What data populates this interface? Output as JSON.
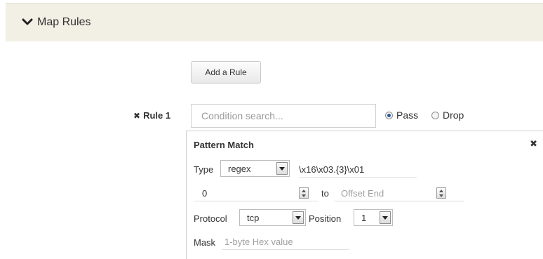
{
  "section": {
    "title": "Map Rules"
  },
  "actions": {
    "add_rule_label": "Add a Rule"
  },
  "rule": {
    "label": "Rule 1",
    "condition_placeholder": "Condition search...",
    "pass_label": "Pass",
    "drop_label": "Drop",
    "selected": "Pass"
  },
  "pattern_match": {
    "title": "Pattern Match",
    "type_label": "Type",
    "type_value": "regex",
    "pattern_value": "\\x16\\x03.{3}\\x01",
    "offset_start": "0",
    "to_label": "to",
    "offset_end_placeholder": "Offset End",
    "protocol_label": "Protocol",
    "protocol_value": "tcp",
    "position_label": "Position",
    "position_value": "1",
    "mask_label": "Mask",
    "mask_placeholder": "1-byte Hex value"
  },
  "icons": {
    "collapse": "chevron-down-icon",
    "delete_rule": "close-icon",
    "close_panel": "close-icon"
  },
  "colors": {
    "header_bg": "#f2efe4",
    "radio_selected": "#2a5a9a"
  }
}
